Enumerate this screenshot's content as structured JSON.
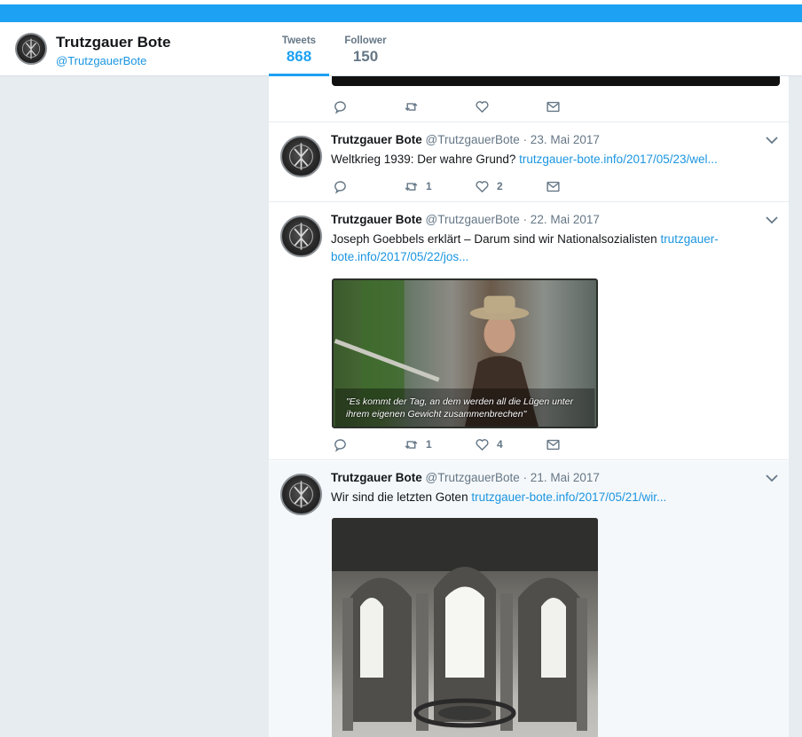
{
  "profile": {
    "name": "Trutzgauer Bote",
    "handle": "@TrutzgauerBote",
    "stats": [
      {
        "label": "Tweets",
        "value": "868"
      },
      {
        "label": "Follower",
        "value": "150"
      }
    ]
  },
  "tweets": [
    {
      "name": "Trutzgauer Bote",
      "handle": "@TrutzgauerBote",
      "date": "· 23. Mai 2017",
      "text": "Weltkrieg 1939: Der wahre Grund?",
      "link": "trutzgauer-bote.info/2017/05/23/wel...",
      "retweets": "1",
      "likes": "2"
    },
    {
      "name": "Trutzgauer Bote",
      "handle": "@TrutzgauerBote",
      "date": "· 22. Mai 2017",
      "text": "Joseph Goebbels erklärt – Darum sind wir Nationalsozialisten",
      "link": "trutzgauer-bote.info/2017/05/22/jos...",
      "retweets": "1",
      "likes": "4",
      "image_caption": "\"Es kommt der Tag, an dem werden all die Lügen unter ihrem eigenen Gewicht zusammenbrechen\""
    },
    {
      "name": "Trutzgauer Bote",
      "handle": "@TrutzgauerBote",
      "date": "· 21. Mai 2017",
      "text": "Wir sind die letzten Goten",
      "link": "trutzgauer-bote.info/2017/05/21/wir..."
    }
  ],
  "colors": {
    "accent": "#1da1f2",
    "link": "#1b95e0",
    "muted": "#657786",
    "background": "#e6ecf0"
  },
  "icons": [
    "reply-icon",
    "retweet-icon",
    "like-icon",
    "direct-message-icon",
    "chevron-down-icon"
  ]
}
